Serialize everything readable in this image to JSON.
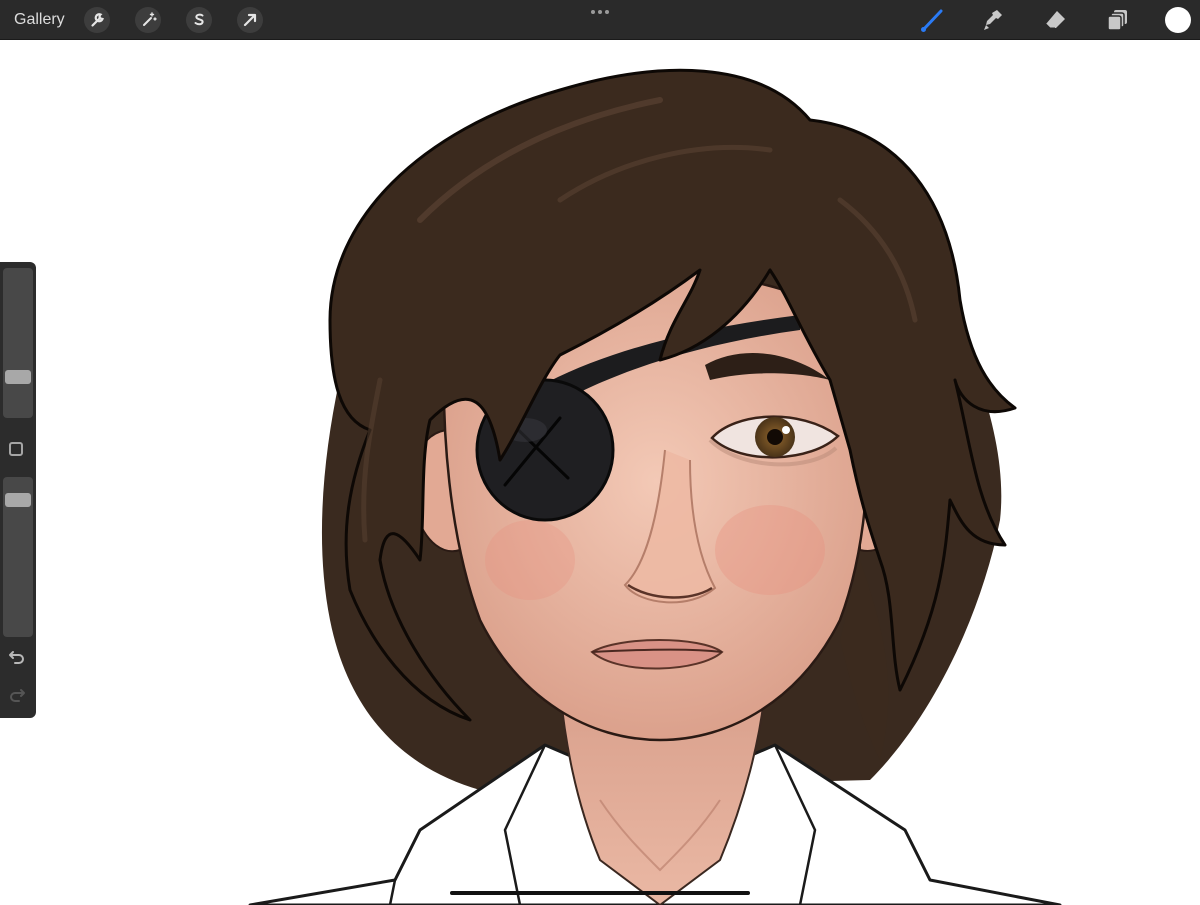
{
  "topbar": {
    "gallery_label": "Gallery",
    "left_tools": [
      {
        "name": "actions",
        "icon": "wrench-icon"
      },
      {
        "name": "adjustments",
        "icon": "magic-wand-icon"
      },
      {
        "name": "selection",
        "icon": "selection-s-icon"
      },
      {
        "name": "transform",
        "icon": "arrow-cursor-icon"
      }
    ],
    "center": {
      "icon": "more-dots-icon"
    },
    "right_tools": [
      {
        "name": "brush",
        "icon": "brush-icon",
        "active": true
      },
      {
        "name": "smudge",
        "icon": "smudge-icon",
        "active": false
      },
      {
        "name": "eraser",
        "icon": "eraser-icon",
        "active": false
      },
      {
        "name": "layers",
        "icon": "layers-icon",
        "active": false
      }
    ],
    "current_color": "#ffffff"
  },
  "sidebar": {
    "brush_size": 0.23,
    "opacity": 0.9,
    "modify_icon": "square-icon",
    "undo_icon": "undo-icon",
    "redo_icon": "redo-icon",
    "redo_enabled": false
  },
  "artwork": {
    "description_colors": {
      "hair": "#3b2a1e",
      "skin": "#e9b8a3",
      "eyepatch": "#1c1c1e",
      "iris": "#6a4a22",
      "shirt": "#ffffff"
    }
  },
  "colors": {
    "toolbar_bg": "#2a2a2a",
    "accent_blue": "#2a7bf6",
    "icon_grey": "#c8c8c8"
  }
}
